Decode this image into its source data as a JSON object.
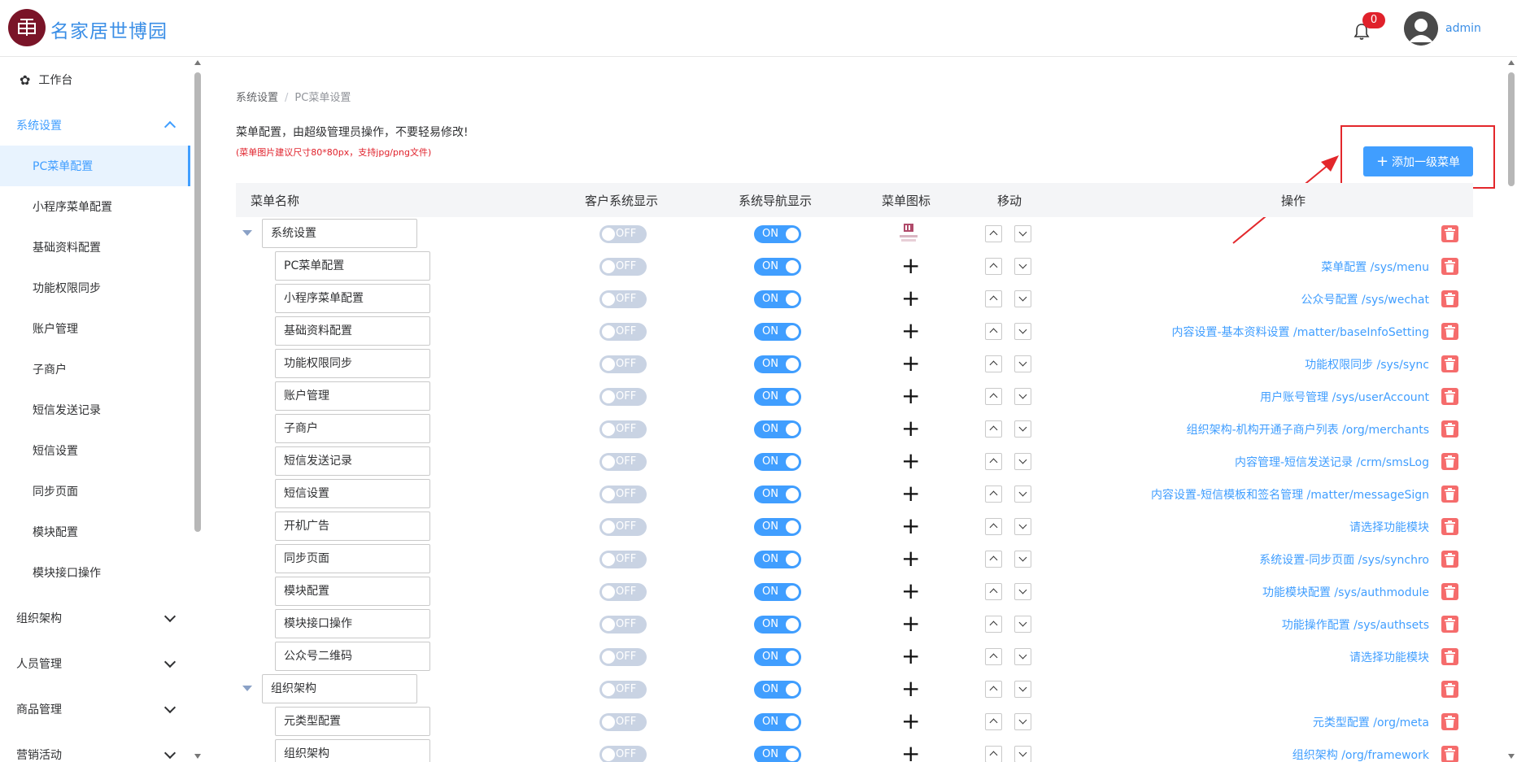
{
  "header": {
    "brand": "名家居世博园",
    "notification_count": "0",
    "username": "admin"
  },
  "sidebar": {
    "items": [
      {
        "label": "工作台"
      },
      {
        "label": "系统设置"
      },
      {
        "label": "PC菜单配置"
      },
      {
        "label": "小程序菜单配置"
      },
      {
        "label": "基础资料配置"
      },
      {
        "label": "功能权限同步"
      },
      {
        "label": "账户管理"
      },
      {
        "label": "子商户"
      },
      {
        "label": "短信发送记录"
      },
      {
        "label": "短信设置"
      },
      {
        "label": "同步页面"
      },
      {
        "label": "模块配置"
      },
      {
        "label": "模块接口操作"
      },
      {
        "label": "组织架构"
      },
      {
        "label": "人员管理"
      },
      {
        "label": "商品管理"
      },
      {
        "label": "营销活动"
      }
    ]
  },
  "breadcrumb": {
    "parent": "系统设置",
    "separator": "/",
    "current": "PC菜单设置"
  },
  "notice": "菜单配置，由超级管理员操作，不要轻易修改!",
  "warning": "(菜单图片建议尺寸80*80px，支持jpg/png文件)",
  "add_button": "添加一级菜单",
  "table": {
    "headers": {
      "name": "菜单名称",
      "customer_display": "客户系统显示",
      "nav_display": "系统导航显示",
      "icon": "菜单图标",
      "move": "移动",
      "actions": "操作"
    },
    "toggle_on": "ON",
    "toggle_off": "OFF",
    "rows": [
      {
        "name": "系统设置",
        "customer": "OFF",
        "nav": "ON",
        "action": ""
      },
      {
        "name": "PC菜单配置",
        "customer": "OFF",
        "nav": "ON",
        "action": "菜单配置 /sys/menu"
      },
      {
        "name": "小程序菜单配置",
        "customer": "OFF",
        "nav": "ON",
        "action": "公众号配置 /sys/wechat"
      },
      {
        "name": "基础资料配置",
        "customer": "OFF",
        "nav": "ON",
        "action": "内容设置-基本资料设置 /matter/baseInfoSetting"
      },
      {
        "name": "功能权限同步",
        "customer": "OFF",
        "nav": "ON",
        "action": "功能权限同步 /sys/sync"
      },
      {
        "name": "账户管理",
        "customer": "OFF",
        "nav": "ON",
        "action": "用户账号管理 /sys/userAccount"
      },
      {
        "name": "子商户",
        "customer": "OFF",
        "nav": "ON",
        "action": "组织架构-机构开通子商户列表 /org/merchants"
      },
      {
        "name": "短信发送记录",
        "customer": "OFF",
        "nav": "ON",
        "action": "内容管理-短信发送记录 /crm/smsLog"
      },
      {
        "name": "短信设置",
        "customer": "OFF",
        "nav": "ON",
        "action": "内容设置-短信模板和签名管理 /matter/messageSign"
      },
      {
        "name": "开机广告",
        "customer": "OFF",
        "nav": "ON",
        "action": "请选择功能模块"
      },
      {
        "name": "同步页面",
        "customer": "OFF",
        "nav": "ON",
        "action": "系统设置-同步页面 /sys/synchro"
      },
      {
        "name": "模块配置",
        "customer": "OFF",
        "nav": "ON",
        "action": "功能模块配置 /sys/authmodule"
      },
      {
        "name": "模块接口操作",
        "customer": "OFF",
        "nav": "ON",
        "action": "功能操作配置 /sys/authsets"
      },
      {
        "name": "公众号二维码",
        "customer": "OFF",
        "nav": "ON",
        "action": "请选择功能模块"
      },
      {
        "name": "组织架构",
        "customer": "OFF",
        "nav": "ON",
        "action": ""
      },
      {
        "name": "元类型配置",
        "customer": "OFF",
        "nav": "ON",
        "action": "元类型配置 /org/meta"
      },
      {
        "name": "组织架构",
        "customer": "OFF",
        "nav": "ON",
        "action": "组织架构 /org/framework"
      }
    ]
  },
  "colors": {
    "accent": "#409eff",
    "brand": "#7a1428",
    "danger": "#f56c6c",
    "annotation": "#e3272b"
  }
}
